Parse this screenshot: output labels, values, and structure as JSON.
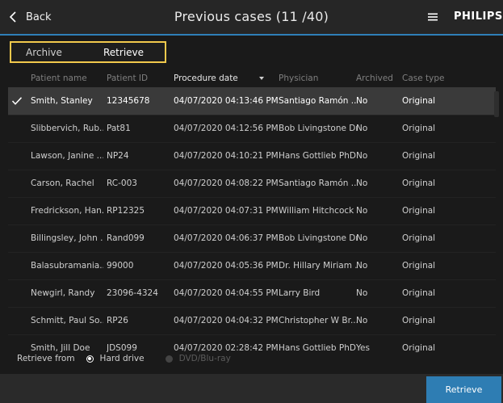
{
  "header": {
    "back_label": "Back",
    "title": "Previous cases (11 /40)",
    "brand": "PHILIPS"
  },
  "tabs": [
    {
      "label": "Archive"
    },
    {
      "label": "Retrieve"
    }
  ],
  "table": {
    "columns": [
      "Patient name",
      "Patient ID",
      "Procedure date",
      "Physician",
      "Archived",
      "Case type"
    ],
    "rows": [
      {
        "name": "Smith, Stanley",
        "id": "12345678",
        "date": "04/07/2020 04:13:46 PM",
        "physician": "Santiago Ramón ...",
        "archived": "No",
        "type": "Original"
      },
      {
        "name": "Slibbervich, Rub...",
        "id": "Pat81",
        "date": "04/07/2020 04:12:56 PM",
        "physician": "Bob Livingstone Dr.",
        "archived": "No",
        "type": "Original"
      },
      {
        "name": "Lawson, Janine ...",
        "id": "NP24",
        "date": "04/07/2020 04:10:21 PM",
        "physician": "Hans Gottlieb PhD",
        "archived": "No",
        "type": "Original"
      },
      {
        "name": "Carson, Rachel",
        "id": "RC-003",
        "date": "04/07/2020 04:08:22 PM",
        "physician": "Santiago Ramón ...",
        "archived": "No",
        "type": "Original"
      },
      {
        "name": "Fredrickson, Han...",
        "id": "RP12325",
        "date": "04/07/2020 04:07:31 PM",
        "physician": "William Hitchcock ...",
        "archived": "No",
        "type": "Original"
      },
      {
        "name": "Billingsley, John ...",
        "id": "Rand099",
        "date": "04/07/2020 04:06:37 PM",
        "physician": "Bob Livingstone Dr.",
        "archived": "No",
        "type": "Original"
      },
      {
        "name": "Balasubramania...",
        "id": "99000",
        "date": "04/07/2020 04:05:36 PM",
        "physician": "Dr. Hillary Miriam ...",
        "archived": "No",
        "type": "Original"
      },
      {
        "name": "Newgirl, Randy",
        "id": "23096-4324",
        "date": "04/07/2020 04:04:55 PM",
        "physician": "Larry Bird",
        "archived": "No",
        "type": "Original"
      },
      {
        "name": "Schmitt, Paul So...",
        "id": "RP26",
        "date": "04/07/2020 04:04:32 PM",
        "physician": "Christopher W Br...",
        "archived": "No",
        "type": "Original"
      },
      {
        "name": "Smith, Jill Doe",
        "id": "JDS099",
        "date": "04/07/2020 02:28:42 PM",
        "physician": "Hans Gottlieb PhD",
        "archived": "Yes",
        "type": "Original"
      }
    ]
  },
  "retrieve_from": {
    "label": "Retrieve from",
    "options": [
      {
        "label": "Hard drive",
        "selected": true
      },
      {
        "label": "DVD/Blu-ray",
        "selected": false
      }
    ]
  },
  "footer": {
    "retrieve_button": "Retrieve"
  },
  "colors": {
    "accent": "#2f7fb8",
    "tab_highlight": "#f2c94c",
    "background": "#1a1a1a"
  }
}
